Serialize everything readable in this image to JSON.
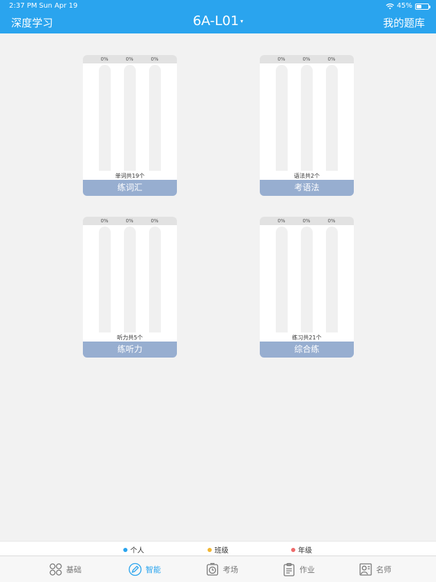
{
  "status": {
    "time": "2:37 PM",
    "date": "Sun Apr 19",
    "battery": "45%",
    "battery_level": 0.45
  },
  "nav": {
    "left": "深度学习",
    "title": "6A-L01",
    "title_caret": "▾",
    "right": "我的题库"
  },
  "cards": [
    {
      "count": "单词共19个",
      "button": "练词汇",
      "bars": [
        {
          "pct": "0%",
          "level": 0
        },
        {
          "pct": "0%",
          "level": 0
        },
        {
          "pct": "0%",
          "level": 0
        }
      ]
    },
    {
      "count": "语法共2个",
      "button": "考语法",
      "bars": [
        {
          "pct": "0%",
          "level": 0
        },
        {
          "pct": "0%",
          "level": 0
        },
        {
          "pct": "0%",
          "level": 0
        }
      ]
    },
    {
      "count": "听力共5个",
      "button": "练听力",
      "bars": [
        {
          "pct": "0%",
          "level": 0
        },
        {
          "pct": "0%",
          "level": 0
        },
        {
          "pct": "0%",
          "level": 0
        }
      ]
    },
    {
      "count": "练习共21个",
      "button": "综合练",
      "bars": [
        {
          "pct": "0%",
          "level": 0
        },
        {
          "pct": "0%",
          "level": 0
        },
        {
          "pct": "0%",
          "level": 0
        }
      ]
    }
  ],
  "legend": [
    {
      "label": "个人",
      "color": "#2aa4ee"
    },
    {
      "label": "班级",
      "color": "#f2b632"
    },
    {
      "label": "年级",
      "color": "#ee6b6b"
    }
  ],
  "tabs": [
    {
      "label": "基础",
      "icon": "grid-icon",
      "active": false
    },
    {
      "label": "智能",
      "icon": "pencil-circle-icon",
      "active": true
    },
    {
      "label": "考场",
      "icon": "clock-icon",
      "active": false
    },
    {
      "label": "作业",
      "icon": "clipboard-icon",
      "active": false
    },
    {
      "label": "名师",
      "icon": "teacher-icon",
      "active": false
    }
  ],
  "colors": {
    "accent": "#2aa4ee",
    "card_button": "#97aed0"
  }
}
